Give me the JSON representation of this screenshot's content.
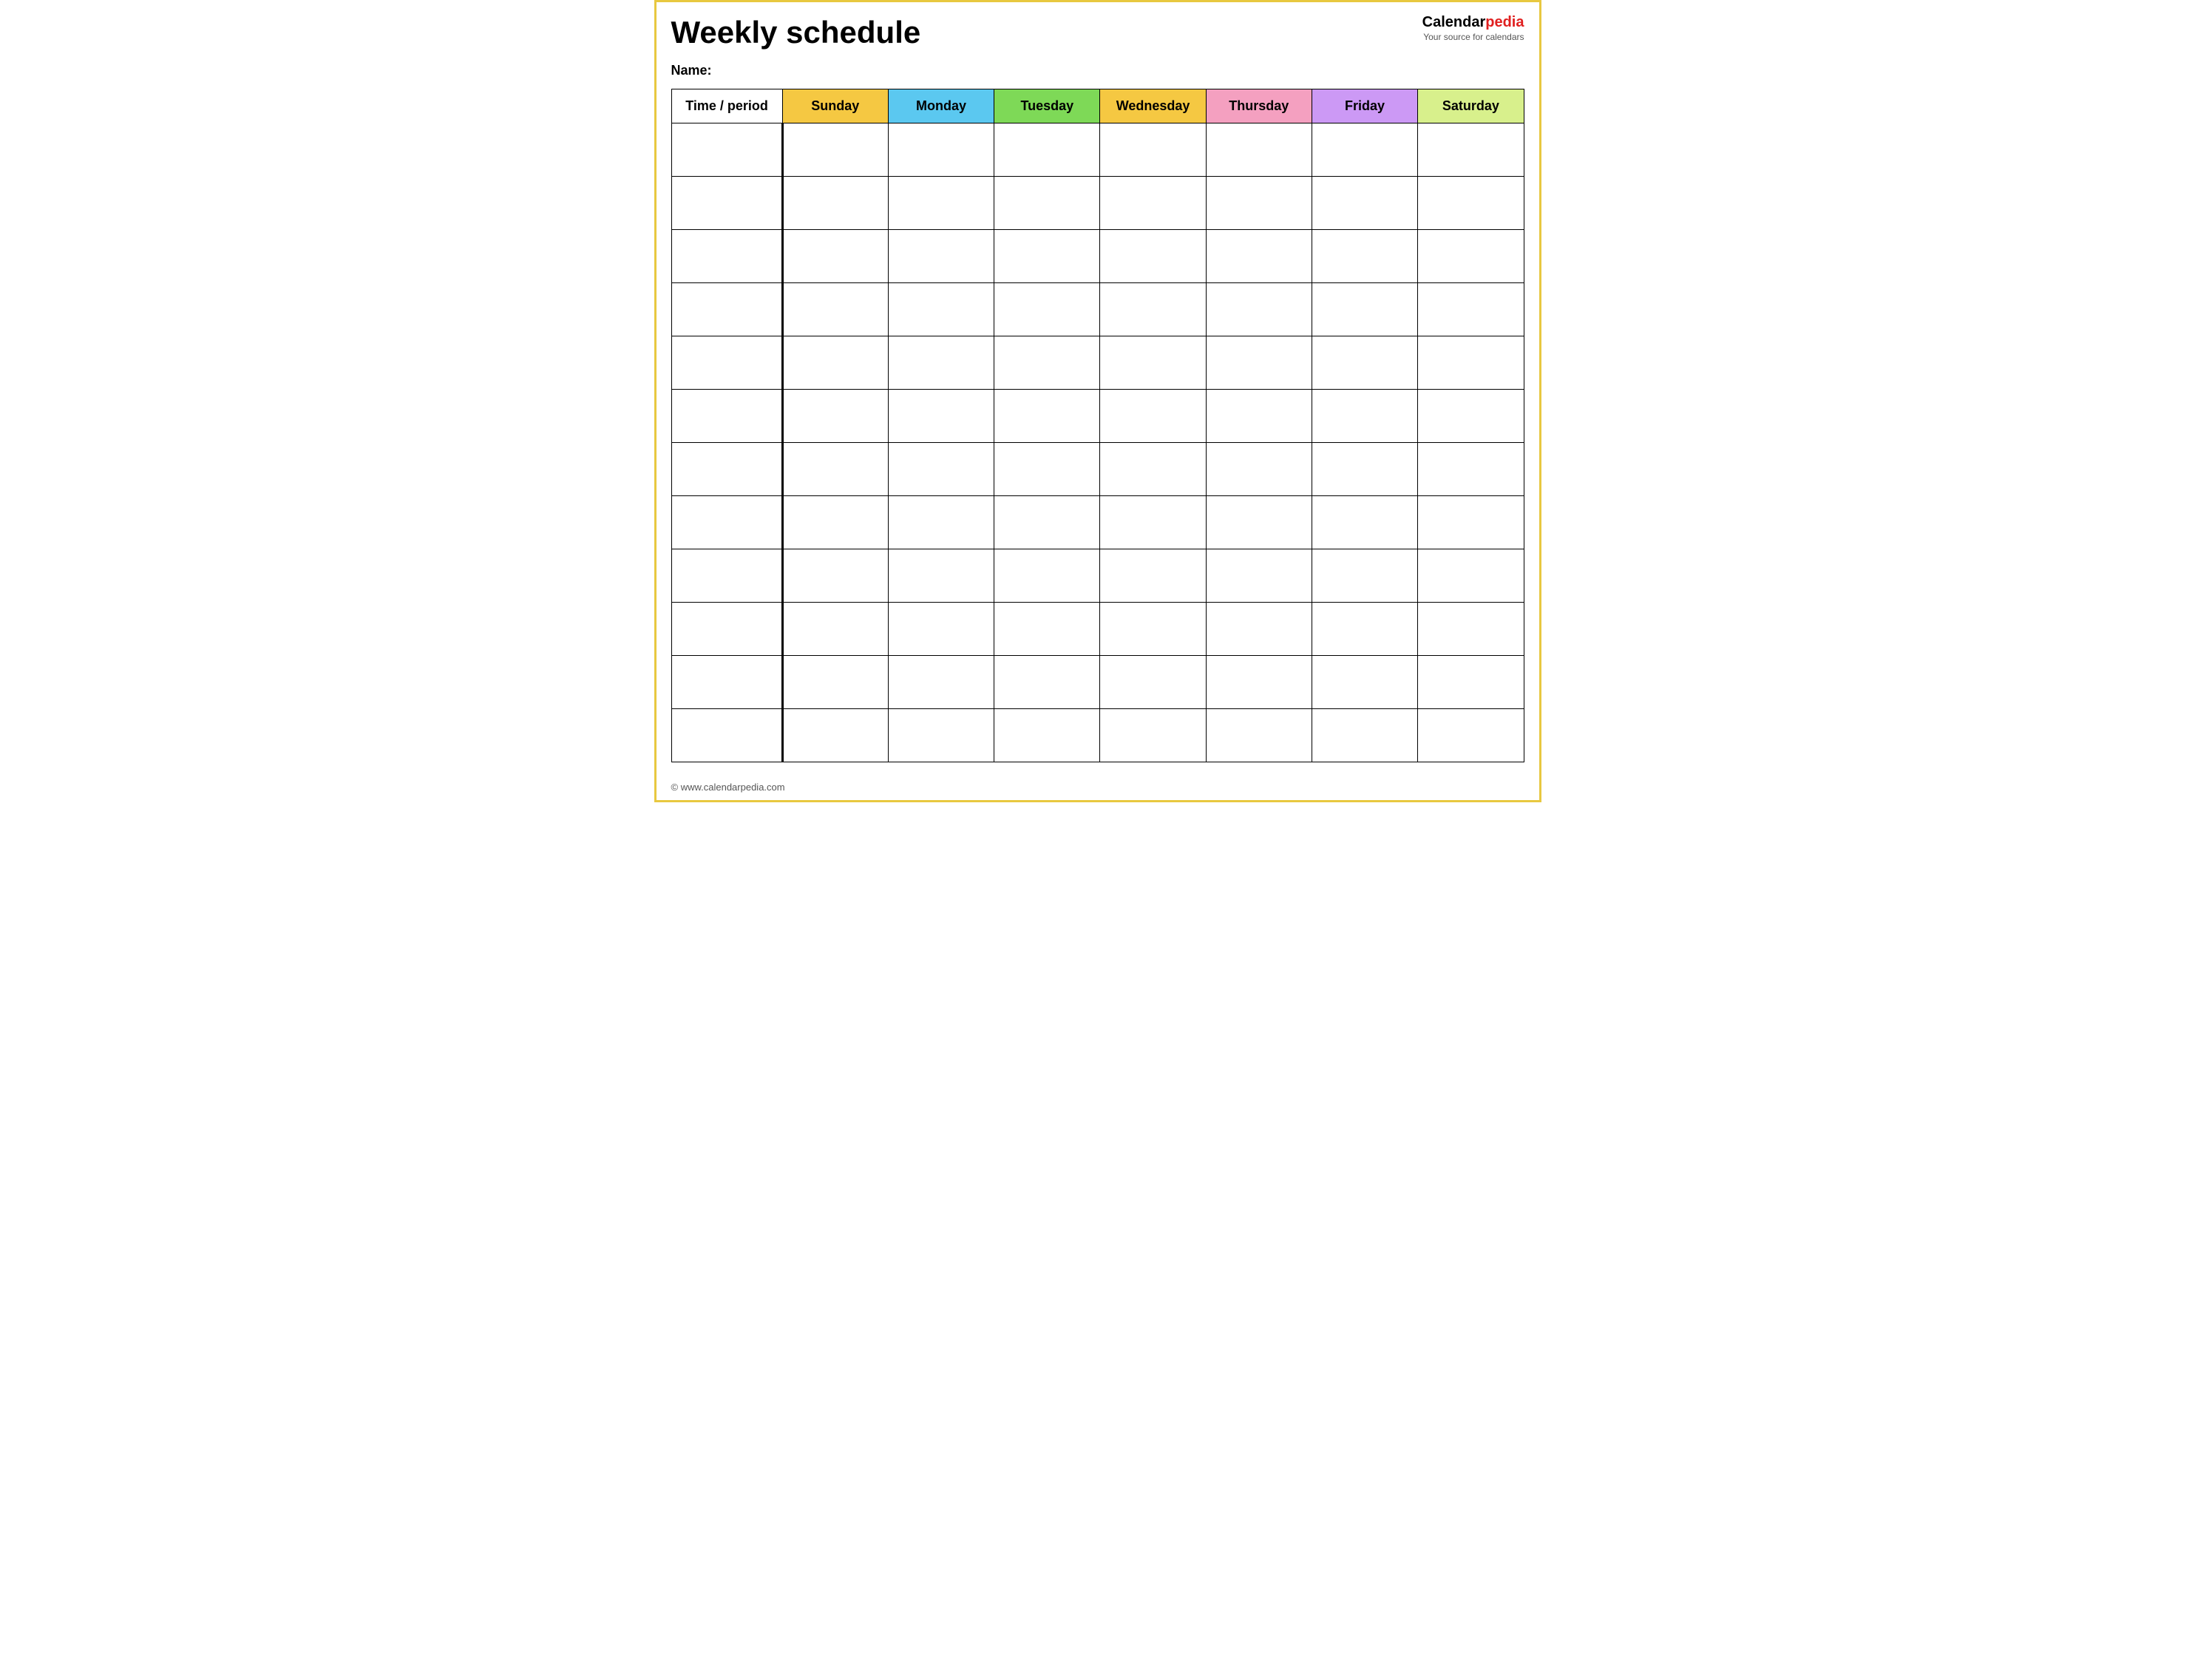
{
  "header": {
    "title": "Weekly schedule",
    "brand": {
      "calendar": "Calendar",
      "pedia": "pedia",
      "tagline": "Your source for calendars"
    },
    "name_label": "Name:"
  },
  "table": {
    "columns": [
      {
        "id": "time",
        "label": "Time / period",
        "class": "col-time"
      },
      {
        "id": "sunday",
        "label": "Sunday",
        "class": "col-sunday"
      },
      {
        "id": "monday",
        "label": "Monday",
        "class": "col-monday"
      },
      {
        "id": "tuesday",
        "label": "Tuesday",
        "class": "col-tuesday"
      },
      {
        "id": "wednesday",
        "label": "Wednesday",
        "class": "col-wednesday"
      },
      {
        "id": "thursday",
        "label": "Thursday",
        "class": "col-thursday"
      },
      {
        "id": "friday",
        "label": "Friday",
        "class": "col-friday"
      },
      {
        "id": "saturday",
        "label": "Saturday",
        "class": "col-saturday"
      }
    ],
    "row_count": 12
  },
  "footer": {
    "url": "www.calendarpedia.com"
  }
}
